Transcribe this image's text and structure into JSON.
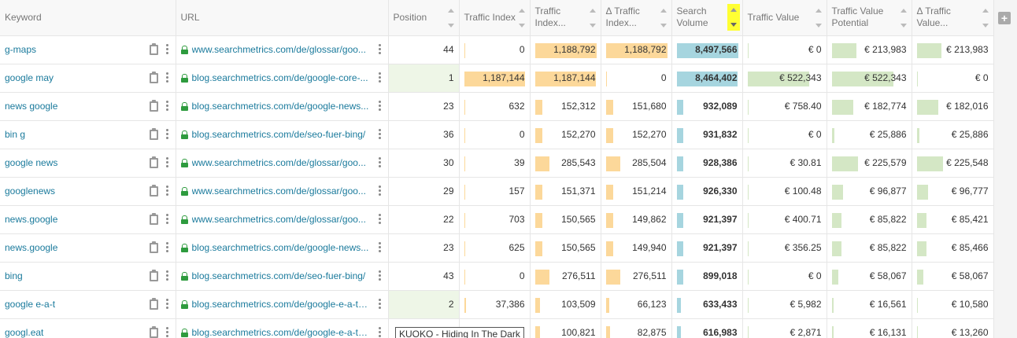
{
  "headers": {
    "keyword": "Keyword",
    "url": "URL",
    "position": "Position",
    "traffic_index": "Traffic Index",
    "traffic_index_2": "Traffic Index...",
    "delta_traffic_index": "Δ Traffic Index...",
    "search_volume": "Search Volume",
    "traffic_value": "Traffic Value",
    "traffic_value_potential": "Traffic Value Potential",
    "delta_traffic_value": "Δ Traffic Value..."
  },
  "sorted_column": "search_volume",
  "colors": {
    "orange_bar": "#fcd89a",
    "blue_bar": "#a6d5df",
    "green_bar": "#d4e7c5",
    "link": "#1a7a9c",
    "sort_highlight": "#ffff33"
  },
  "rows": [
    {
      "keyword": "g-maps",
      "url": "www.searchmetrics.com/de/glossar/goo...",
      "position": "44",
      "ti": "0",
      "ti2": "1,188,792",
      "dti": "1,188,792",
      "sv": "8,497,566",
      "tv": "€ 0",
      "tvp": "€ 213,983",
      "dtv": "€ 213,983",
      "pos_hl": false
    },
    {
      "keyword": "google may",
      "url": "blog.searchmetrics.com/de/google-core-...",
      "position": "1",
      "ti": "1,187,144",
      "ti2": "1,187,144",
      "dti": "0",
      "sv": "8,464,402",
      "tv": "€ 522,343",
      "tvp": "€ 522,343",
      "dtv": "€ 0",
      "pos_hl": true
    },
    {
      "keyword": "news google",
      "url": "blog.searchmetrics.com/de/google-news...",
      "position": "23",
      "ti": "632",
      "ti2": "152,312",
      "dti": "151,680",
      "sv": "932,089",
      "tv": "€ 758.40",
      "tvp": "€ 182,774",
      "dtv": "€ 182,016",
      "pos_hl": false
    },
    {
      "keyword": "bin g",
      "url": "blog.searchmetrics.com/de/seo-fuer-bing/",
      "position": "36",
      "ti": "0",
      "ti2": "152,270",
      "dti": "152,270",
      "sv": "931,832",
      "tv": "€ 0",
      "tvp": "€ 25,886",
      "dtv": "€ 25,886",
      "pos_hl": false
    },
    {
      "keyword": "google news",
      "url": "www.searchmetrics.com/de/glossar/goo...",
      "position": "30",
      "ti": "39",
      "ti2": "285,543",
      "dti": "285,504",
      "sv": "928,386",
      "tv": "€ 30.81",
      "tvp": "€ 225,579",
      "dtv": "€ 225,548",
      "pos_hl": false
    },
    {
      "keyword": "googlenews",
      "url": "www.searchmetrics.com/de/glossar/goo...",
      "position": "29",
      "ti": "157",
      "ti2": "151,371",
      "dti": "151,214",
      "sv": "926,330",
      "tv": "€ 100.48",
      "tvp": "€ 96,877",
      "dtv": "€ 96,777",
      "pos_hl": false
    },
    {
      "keyword": "news.google",
      "url": "www.searchmetrics.com/de/glossar/goo...",
      "position": "22",
      "ti": "703",
      "ti2": "150,565",
      "dti": "149,862",
      "sv": "921,397",
      "tv": "€ 400.71",
      "tvp": "€ 85,822",
      "dtv": "€ 85,421",
      "pos_hl": false
    },
    {
      "keyword": "news.google",
      "url": "blog.searchmetrics.com/de/google-news...",
      "position": "23",
      "ti": "625",
      "ti2": "150,565",
      "dti": "149,940",
      "sv": "921,397",
      "tv": "€ 356.25",
      "tvp": "€ 85,822",
      "dtv": "€ 85,466",
      "pos_hl": false
    },
    {
      "keyword": "bing",
      "url": "blog.searchmetrics.com/de/seo-fuer-bing/",
      "position": "43",
      "ti": "0",
      "ti2": "276,511",
      "dti": "276,511",
      "sv": "899,018",
      "tv": "€ 0",
      "tvp": "€ 58,067",
      "dtv": "€ 58,067",
      "pos_hl": false
    },
    {
      "keyword": "google e-a-t",
      "url": "blog.searchmetrics.com/de/google-e-a-t-r...",
      "position": "2",
      "ti": "37,386",
      "ti2": "103,509",
      "dti": "66,123",
      "sv": "633,433",
      "tv": "€ 5,982",
      "tvp": "€ 16,561",
      "dtv": "€ 10,580",
      "pos_hl": true
    },
    {
      "keyword": "googl.eat",
      "url": "blog.searchmetrics.com/de/google-e-a-t-r...",
      "position": "",
      "ti": "",
      "ti2": "100,821",
      "dti": "82,875",
      "sv": "616,983",
      "tv": "€ 2,871",
      "tvp": "€ 16,131",
      "dtv": "€ 13,260",
      "pos_hl": false
    }
  ],
  "tooltip": "KUOKO - Hiding In The Dark"
}
